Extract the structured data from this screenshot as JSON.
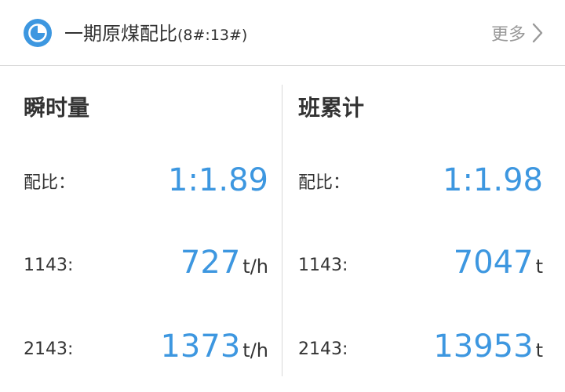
{
  "header": {
    "title": "一期原煤配比",
    "subtitle": "(8#:13#)",
    "more_label": "更多",
    "icon": "pie-chart-icon",
    "accent_color": "#3d97e0"
  },
  "left_panel": {
    "title": "瞬时量",
    "rows": [
      {
        "label": "配比：",
        "value": "1:1.89",
        "unit": ""
      },
      {
        "label": "1143:",
        "value": "727",
        "unit": "t/h"
      },
      {
        "label": "2143:",
        "value": "1373",
        "unit": "t/h"
      }
    ]
  },
  "right_panel": {
    "title": "班累计",
    "rows": [
      {
        "label": "配比：",
        "value": "1:1.98",
        "unit": ""
      },
      {
        "label": "1143:",
        "value": "7047",
        "unit": "t"
      },
      {
        "label": "2143:",
        "value": "13953",
        "unit": "t"
      }
    ]
  }
}
